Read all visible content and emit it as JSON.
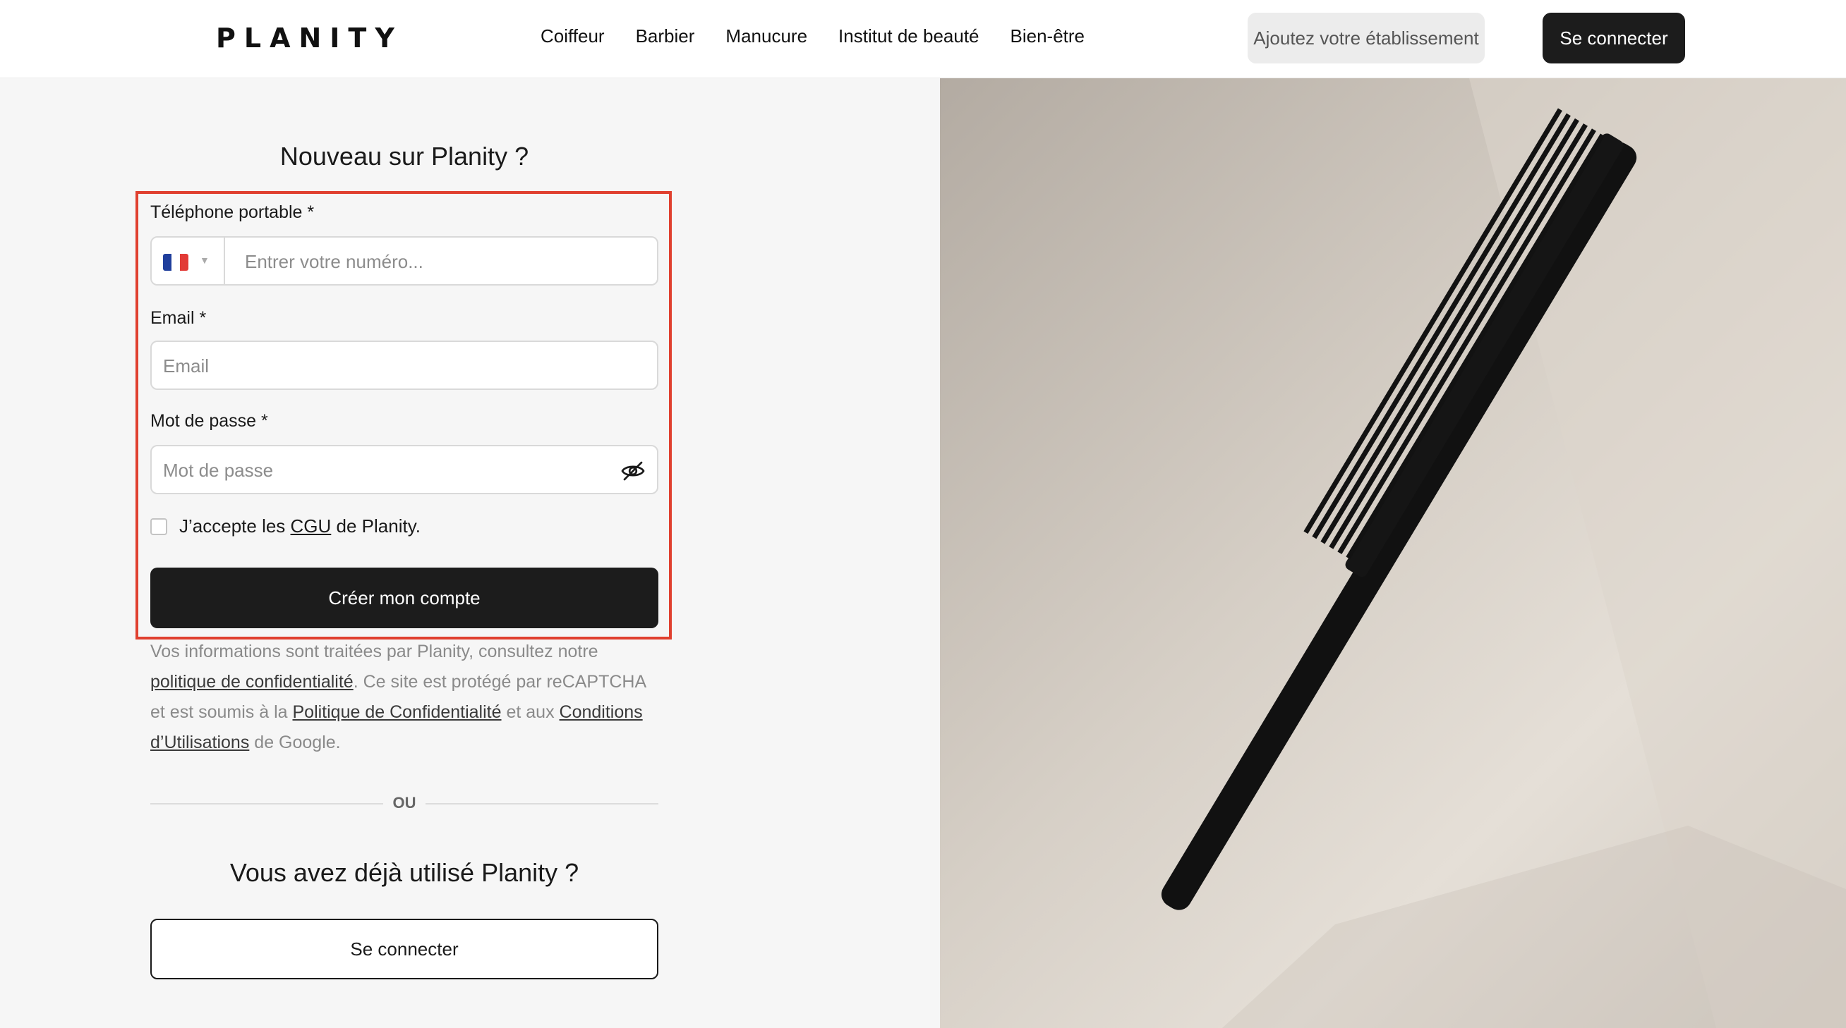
{
  "header": {
    "logo": "PLANITY",
    "nav": [
      "Coiffeur",
      "Barbier",
      "Manucure",
      "Institut de beauté",
      "Bien-être"
    ],
    "add_business": "Ajoutez votre établissement",
    "login": "Se connecter"
  },
  "signup": {
    "title": "Nouveau sur Planity ?",
    "phone_label": "Téléphone portable *",
    "phone_placeholder": "Entrer votre numéro...",
    "country_flag": "flag-france",
    "email_label": "Email *",
    "email_placeholder": "Email",
    "password_label": "Mot de passe *",
    "password_placeholder": "Mot de passe",
    "accept_pre": "J’accepte les ",
    "accept_link": "CGU",
    "accept_post": " de Planity.",
    "submit": "Créer mon compte"
  },
  "legal": {
    "t1": "Vos informations sont traitées par Planity, consultez notre ",
    "l1": "politique de confidentialité",
    "t2": ". Ce site est protégé par reCAPTCHA et est soumis à la ",
    "l2": "Politique de Confidentialité",
    "t3": " et aux ",
    "l3": "Conditions d’Utilisations",
    "t4": " de Google."
  },
  "divider": "OU",
  "existing": {
    "title": "Vous avez déjà utilisé Planity ?",
    "login": "Se connecter"
  },
  "colors": {
    "highlight": "#e0402f",
    "primary_button": "#1c1c1c",
    "panel_bg": "#f6f6f6"
  }
}
